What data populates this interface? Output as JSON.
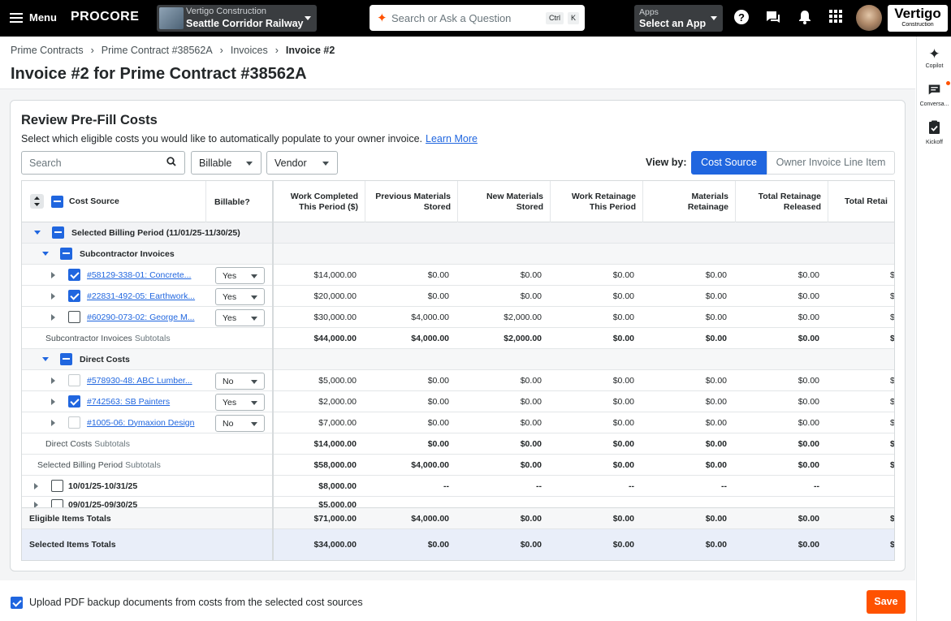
{
  "topbar": {
    "menu_label": "Menu",
    "logo": "PROCORE",
    "company": "Vertigo Construction",
    "project": "Seattle Corridor Railway",
    "search_placeholder": "Search or Ask a Question",
    "kbd_ctrl": "Ctrl",
    "kbd_k": "K",
    "apps_label": "Apps",
    "apps_value": "Select an App",
    "brand_logo": "Vertigo",
    "brand_sub": "Construction"
  },
  "rail": {
    "copilot": "Copilot",
    "conversations": "Conversa...",
    "kickoff": "Kickoff"
  },
  "breadcrumb": [
    "Prime Contracts",
    "Prime Contract #38562A",
    "Invoices",
    "Invoice #2"
  ],
  "page_title": "Invoice #2 for Prime Contract #38562A",
  "card": {
    "heading": "Review Pre-Fill Costs",
    "subtitle": "Select which eligible costs you would like to automatically populate to your owner invoice.",
    "learn_more": "Learn More",
    "search_placeholder": "Search",
    "filter_billable": "Billable",
    "filter_vendor": "Vendor",
    "view_by": "View by:",
    "view_cost_source": "Cost Source",
    "view_owner_line": "Owner Invoice Line Item"
  },
  "columns": {
    "cost_source": "Cost Source",
    "billable": "Billable?",
    "c1a": "Work Completed",
    "c1b": "This Period ($)",
    "c2a": "Previous Materials",
    "c2b": "Stored",
    "c3a": "New Materials",
    "c3b": "Stored",
    "c4a": "Work Retainage",
    "c4b": "This Period",
    "c5a": "Materials",
    "c5b": "Retainage",
    "c6a": "Total Retainage",
    "c6b": "Released",
    "c7a": "Total Retai"
  },
  "rows": [
    {
      "kind": "group",
      "level": 0,
      "label": "Selected Billing Period (11/01/25-11/30/25)",
      "cb": "part",
      "expanded": true
    },
    {
      "kind": "group",
      "level": 1,
      "label": "Subcontractor Invoices",
      "cb": "part",
      "expanded": true
    },
    {
      "kind": "item",
      "label": "#58129-338-01: Concrete...",
      "cb": "on",
      "billable": "Yes",
      "vals": [
        "$14,000.00",
        "$0.00",
        "$0.00",
        "$0.00",
        "$0.00",
        "$0.00",
        "$"
      ]
    },
    {
      "kind": "item",
      "label": "#22831-492-05: Earthwork...",
      "cb": "on",
      "billable": "Yes",
      "vals": [
        "$20,000.00",
        "$0.00",
        "$0.00",
        "$0.00",
        "$0.00",
        "$0.00",
        "$"
      ]
    },
    {
      "kind": "item",
      "label": "#60290-073-02: George M...",
      "cb": "off",
      "billable": "Yes",
      "vals": [
        "$30,000.00",
        "$4,000.00",
        "$2,000.00",
        "$0.00",
        "$0.00",
        "$0.00",
        "$"
      ]
    },
    {
      "kind": "subtotal",
      "level": 1,
      "label": "Subcontractor Invoices",
      "suffix": "Subtotals",
      "vals": [
        "$44,000.00",
        "$4,000.00",
        "$2,000.00",
        "$0.00",
        "$0.00",
        "$0.00",
        "$"
      ]
    },
    {
      "kind": "group",
      "level": 1,
      "label": "Direct Costs",
      "cb": "part",
      "expanded": true
    },
    {
      "kind": "item",
      "label": "#578930-48: ABC Lumber...",
      "cb": "dis",
      "billable": "No",
      "vals": [
        "$5,000.00",
        "$0.00",
        "$0.00",
        "$0.00",
        "$0.00",
        "$0.00",
        "$"
      ]
    },
    {
      "kind": "item",
      "label": "#742563: SB Painters",
      "cb": "on",
      "billable": "Yes",
      "vals": [
        "$2,000.00",
        "$0.00",
        "$0.00",
        "$0.00",
        "$0.00",
        "$0.00",
        "$"
      ]
    },
    {
      "kind": "item",
      "label": "#1005-06: Dymaxion Design",
      "cb": "dis",
      "billable": "No",
      "vals": [
        "$7,000.00",
        "$0.00",
        "$0.00",
        "$0.00",
        "$0.00",
        "$0.00",
        "$"
      ]
    },
    {
      "kind": "subtotal",
      "level": 1,
      "label": "Direct Costs",
      "suffix": "Subtotals",
      "vals": [
        "$14,000.00",
        "$0.00",
        "$0.00",
        "$0.00",
        "$0.00",
        "$0.00",
        "$"
      ]
    },
    {
      "kind": "subtotal",
      "level": 0,
      "label": "Selected Billing Period",
      "suffix": "Subtotals",
      "vals": [
        "$58,000.00",
        "$4,000.00",
        "$0.00",
        "$0.00",
        "$0.00",
        "$0.00",
        "$"
      ]
    },
    {
      "kind": "period",
      "label": "10/01/25-10/31/25",
      "cb": "off",
      "vals": [
        "$8,000.00",
        "--",
        "--",
        "--",
        "--",
        "--",
        ""
      ]
    },
    {
      "kind": "period",
      "label": "09/01/25-09/30/25",
      "cb": "off",
      "vals": [
        "$5,000.00",
        "",
        "",
        "",
        "",
        "",
        ""
      ]
    }
  ],
  "totals": {
    "eligible_label": "Eligible Items Totals",
    "eligible": [
      "$71,000.00",
      "$4,000.00",
      "$0.00",
      "$0.00",
      "$0.00",
      "$0.00",
      "$"
    ],
    "selected_label": "Selected Items Totals",
    "selected": [
      "$34,000.00",
      "$0.00",
      "$0.00",
      "$0.00",
      "$0.00",
      "$0.00",
      "$"
    ]
  },
  "footer": {
    "upload_label": "Upload PDF backup documents from costs from the selected cost sources",
    "save_label": "Save"
  },
  "colors": {
    "accent": "#2066df",
    "brand": "#ff5200"
  }
}
